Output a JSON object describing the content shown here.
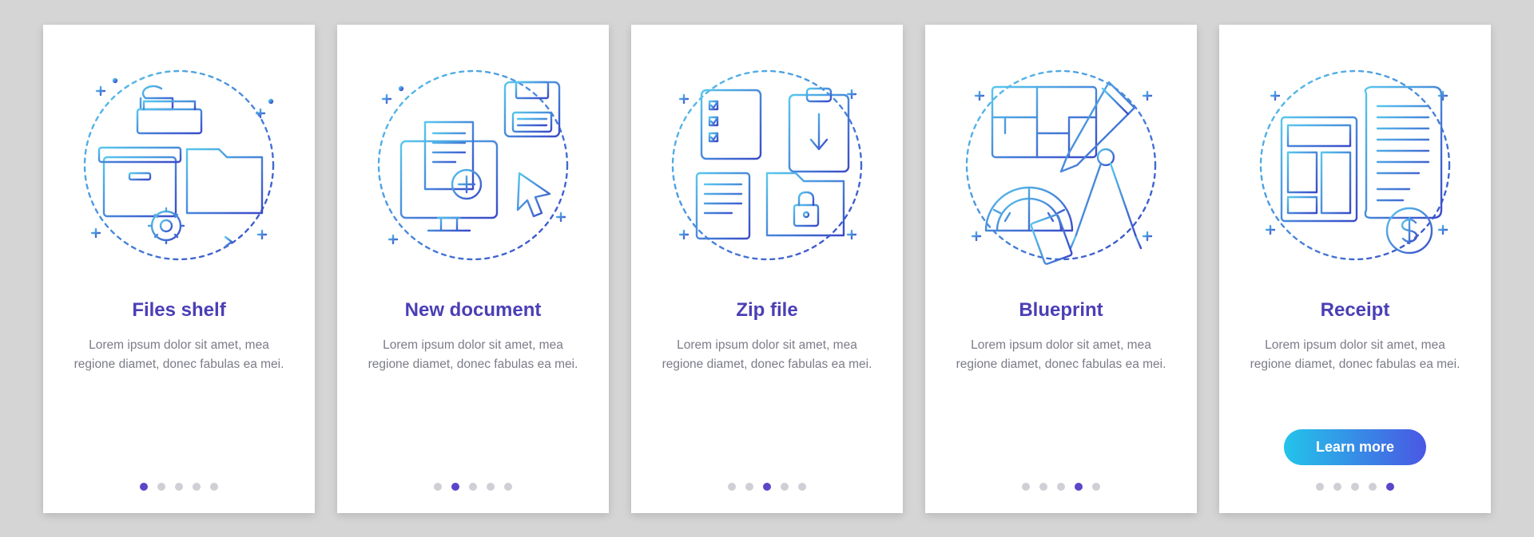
{
  "cards": [
    {
      "title": "Files shelf",
      "desc": "Lorem ipsum dolor sit amet, mea regione diamet, donec fabulas ea mei.",
      "activeIndex": 0,
      "hasButton": false,
      "icon": "files-shelf-icon"
    },
    {
      "title": "New document",
      "desc": "Lorem ipsum dolor sit amet, mea regione diamet, donec fabulas ea mei.",
      "activeIndex": 1,
      "hasButton": false,
      "icon": "new-document-icon"
    },
    {
      "title": "Zip file",
      "desc": "Lorem ipsum dolor sit amet, mea regione diamet, donec fabulas ea mei.",
      "activeIndex": 2,
      "hasButton": false,
      "icon": "zip-file-icon"
    },
    {
      "title": "Blueprint",
      "desc": "Lorem ipsum dolor sit amet, mea regione diamet, donec fabulas ea mei.",
      "activeIndex": 3,
      "hasButton": false,
      "icon": "blueprint-icon"
    },
    {
      "title": "Receipt",
      "desc": "Lorem ipsum dolor sit amet, mea regione diamet, donec fabulas ea mei.",
      "activeIndex": 4,
      "hasButton": true,
      "buttonLabel": "Learn more",
      "icon": "receipt-icon"
    }
  ],
  "dotsCount": 5,
  "colors": {
    "light": "#58c8ed",
    "dark": "#3a4ac8",
    "title": "#4a3fb5",
    "text": "#7c7c89",
    "dot": "#cfcfd6",
    "dotActive": "#5b46c9"
  }
}
